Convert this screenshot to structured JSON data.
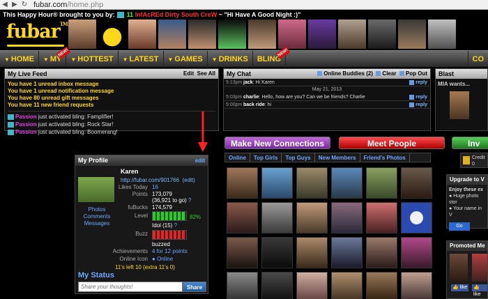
{
  "browser": {
    "url_prefix": "fubar.com",
    "url_path": "/home.php"
  },
  "happy_hour": {
    "prefix": "This Happy Hour® brought to you by:",
    "number": "11",
    "sponsor": "InfAcREd Dirty South CreW",
    "quote": "~ \"Hi Have A Good Night :)\""
  },
  "logo": {
    "text": "fubar",
    "tm": "TM"
  },
  "nav": {
    "items": [
      {
        "label": "HOME",
        "caret": "▼",
        "new": ""
      },
      {
        "label": "MY",
        "caret": "▼",
        "new": "NEW!"
      },
      {
        "label": "HOTTEST",
        "caret": "▼",
        "new": ""
      },
      {
        "label": "LATEST",
        "caret": "▼",
        "new": ""
      },
      {
        "label": "GAMES",
        "caret": "▼",
        "new": ""
      },
      {
        "label": "DRINKS",
        "caret": "▼",
        "new": ""
      },
      {
        "label": "BLING",
        "caret": "",
        "new": "NEW!"
      }
    ],
    "last": "CO"
  },
  "live_feed": {
    "title": "My Live Feed",
    "edit": "Edit",
    "see_all": "See All",
    "alerts": [
      "You have 1 unread inbox message",
      "You have 1 unread notification message",
      "You have 80 unread gift messages",
      "You have 11 new friend requests"
    ],
    "items": [
      {
        "who": "Passion",
        "text": "just activated bling: Famplifier!"
      },
      {
        "who": "Passion",
        "text": "just activated bling: Rock Star!"
      },
      {
        "who": "Passion",
        "text": "just activated bling: Boomerang!"
      }
    ]
  },
  "chat": {
    "title": "My Chat",
    "online_buddies": "Online Buddies (2)",
    "clear": "Clear",
    "popout": "Pop Out",
    "date": "May 21, 2013",
    "messages": [
      {
        "time": "5:13pm",
        "who": "jack",
        "text": ": Hi Karen",
        "reply": "reply"
      },
      {
        "time": "5:03pm",
        "who": "charlie",
        "text": ": Hello, how are you? Can we be friends? Charlie",
        "reply": "reply"
      },
      {
        "time": "5:00pm",
        "who": "back ride",
        "text": ": hi",
        "reply": "reply"
      }
    ]
  },
  "blast": {
    "title": "Blast",
    "text": "MIA wants..."
  },
  "buttons": {
    "connect": "Make New Connections",
    "meet": "Meet People",
    "inv": "Inv"
  },
  "tabs": [
    "Online",
    "Top Girls",
    "Top Guys",
    "New Members",
    "Friend's Photos"
  ],
  "profile": {
    "title": "My Profile",
    "edit": "edit",
    "name": "Karen",
    "url": "http://fubar.com/901766",
    "url_edit": "(edit)",
    "links": [
      "Photos",
      "Comments",
      "Messages"
    ],
    "likes_label": "Likes Today",
    "likes": "16",
    "points_label": "Points",
    "points": "173,079",
    "points_sub": "(36,921 to go)",
    "fubucks_label": "fuBucks",
    "fubucks": "174,579",
    "level_label": "Level",
    "level_pct": "82%",
    "level_value": "Idol (15)",
    "buzz_label": "Buzz",
    "buzz_value": "buzzed",
    "ach_label": "Achievements",
    "ach_value": "4 for 12 points",
    "online_label": "Online Icon",
    "online_value": "Online",
    "elevens": "11's left 10 (extra 11's 0)",
    "status_title": "My Status",
    "status_placeholder": "Share your thoughts!",
    "share": "Share"
  },
  "right": {
    "credits": "Credit",
    "credits_val": "0",
    "upgrade_title": "Upgrade to V",
    "upgrade_body": "Enjoy these ex",
    "upgrade_b1": "Huge photo stor",
    "upgrade_b2": "Your name in V",
    "upgrade_go": "Go",
    "promoted_title": "Promoted Me",
    "like": "like"
  },
  "colors": {
    "accent": "#ffd71a",
    "link": "#6fa7ff"
  }
}
